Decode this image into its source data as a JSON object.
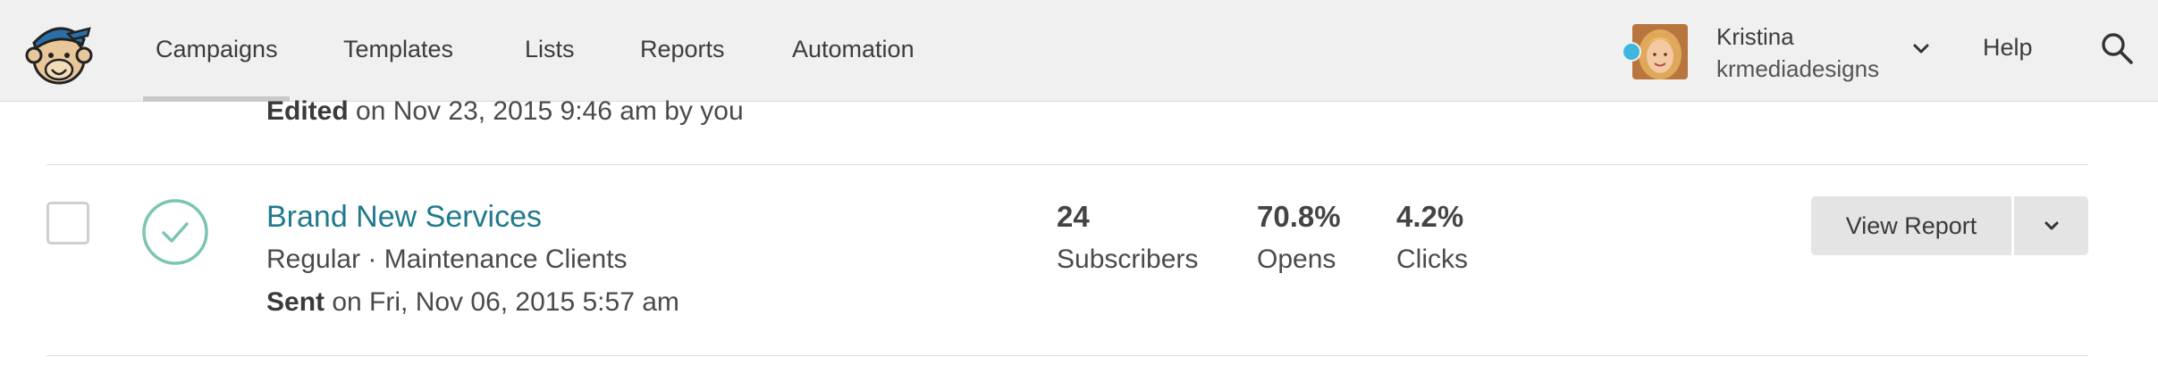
{
  "header": {
    "logo_icon": "mailchimp-freddie-logo",
    "nav": [
      {
        "label": "Campaigns",
        "active": true
      },
      {
        "label": "Templates",
        "active": false
      },
      {
        "label": "Lists",
        "active": false
      },
      {
        "label": "Reports",
        "active": false
      },
      {
        "label": "Automation",
        "active": false
      }
    ],
    "user": {
      "name": "Kristina",
      "account": "krmediadesigns",
      "online_status_color": "#3fb6de",
      "menu_icon": "chevron-down-icon"
    },
    "help_label": "Help",
    "search_icon": "search-icon"
  },
  "campaigns": {
    "previous_item": {
      "status_word": "Edited",
      "status_detail": " on Nov 23, 2015 9:46 am by you"
    },
    "item": {
      "title": "Brand New Services",
      "meta": "Regular · Maintenance Clients",
      "status_word": "Sent",
      "status_detail": " on Fri, Nov 06, 2015 5:57 am",
      "status_icon": "check-circle-icon",
      "stats": [
        {
          "value": "24",
          "label": "Subscribers"
        },
        {
          "value": "70.8%",
          "label": "Opens"
        },
        {
          "value": "4.2%",
          "label": "Clicks"
        }
      ],
      "primary_action": "View Report",
      "menu_icon": "chevron-down-icon"
    }
  },
  "colors": {
    "title_link": "#1f7a8c",
    "sent_check": "#7cc4b4",
    "topbar_bg": "#f0f0f0",
    "button_bg": "#e4e4e4"
  }
}
